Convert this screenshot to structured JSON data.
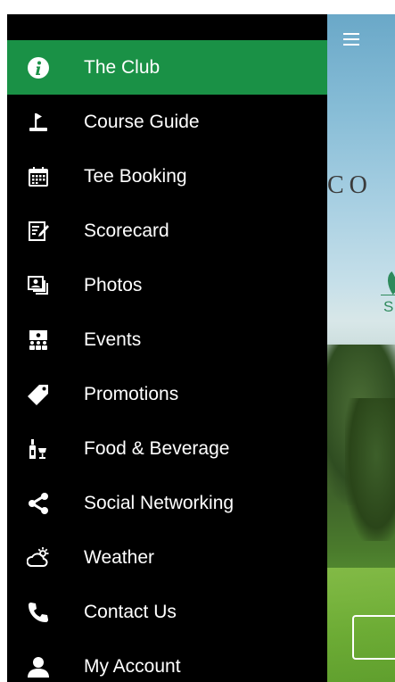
{
  "drawer": {
    "items": [
      {
        "label": "The Club",
        "icon": "info-icon",
        "active": true
      },
      {
        "label": "Course Guide",
        "icon": "flag-icon",
        "active": false
      },
      {
        "label": "Tee Booking",
        "icon": "calendar-icon",
        "active": false
      },
      {
        "label": "Scorecard",
        "icon": "scorecard-icon",
        "active": false
      },
      {
        "label": "Photos",
        "icon": "photos-icon",
        "active": false
      },
      {
        "label": "Events",
        "icon": "events-icon",
        "active": false
      },
      {
        "label": "Promotions",
        "icon": "tag-icon",
        "active": false
      },
      {
        "label": "Food & Beverage",
        "icon": "food-beverage-icon",
        "active": false
      },
      {
        "label": "Social Networking",
        "icon": "share-icon",
        "active": false
      },
      {
        "label": "Weather",
        "icon": "weather-icon",
        "active": false
      },
      {
        "label": "Contact Us",
        "icon": "phone-icon",
        "active": false
      },
      {
        "label": "My Account",
        "icon": "user-icon",
        "active": false
      }
    ]
  },
  "main": {
    "menu_icon": "hamburger-icon",
    "logo_text": "CO",
    "logo_subtext": "S"
  },
  "colors": {
    "drawer_background": "#000000",
    "active_item": "#1a9146",
    "text": "#ffffff",
    "logo_green": "#2e8a5c"
  }
}
